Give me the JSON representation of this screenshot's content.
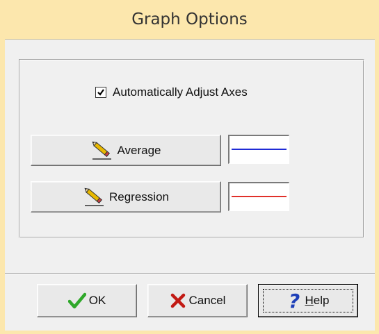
{
  "window": {
    "title": "Graph Options"
  },
  "options": {
    "auto_adjust_label": "Automatically Adjust Axes",
    "auto_adjust_checked": true
  },
  "lines": {
    "average": {
      "label": "Average",
      "color": "#1f2bd6",
      "icon": "pencil-icon"
    },
    "regression": {
      "label": "Regression",
      "color": "#e0302a",
      "icon": "pencil-icon"
    }
  },
  "footer": {
    "ok_label": "OK",
    "ok_icon": "checkmark-icon",
    "cancel_label": "Cancel",
    "cancel_icon": "x-icon",
    "help_label": "Help",
    "help_icon": "question-icon"
  },
  "colors": {
    "title_bar": "#fce7ad",
    "client_bg": "#f0f0f0",
    "ok_green": "#2fa82a",
    "cancel_red": "#c21a14",
    "help_blue": "#1d3fb8"
  }
}
